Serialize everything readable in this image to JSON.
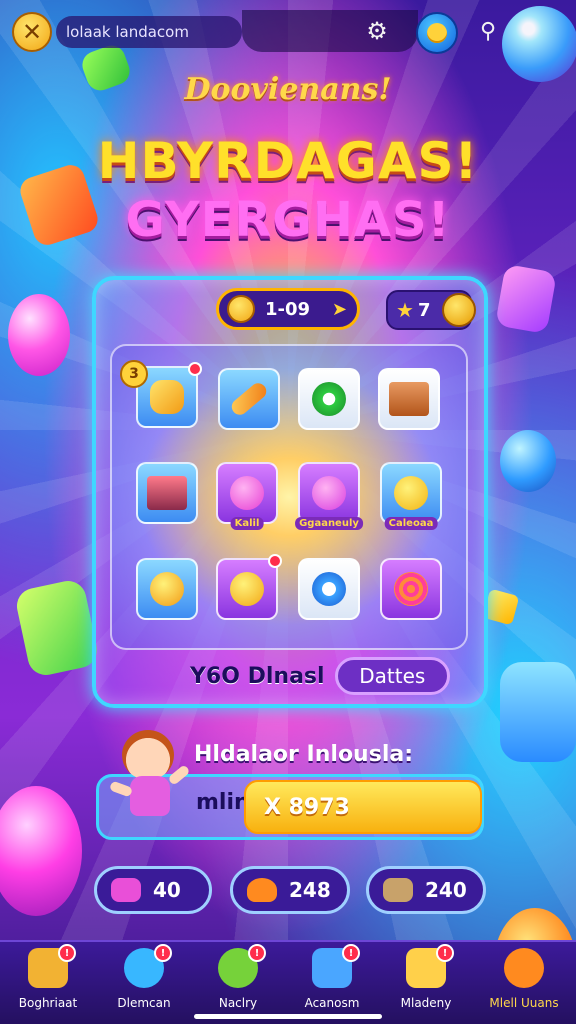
{
  "topbar": {
    "close_icon": "close-icon",
    "search_text": "lolaak landacom",
    "settings_icon": "gear-icon",
    "coin_icon": "coin-icon",
    "pin_icon": "location-pin-icon"
  },
  "titles": {
    "subtitle": "Doovienans!",
    "line1": "HBYRDAGAS!",
    "line2": "GYERGHAS!"
  },
  "panel": {
    "score": "1-09",
    "stars": "7",
    "tiles": [
      {
        "icon": "ice-cream-icon",
        "color": "blue",
        "badge": true,
        "num_badge": "3"
      },
      {
        "icon": "baguette-icon",
        "color": "blue",
        "badge": false
      },
      {
        "icon": "green-donut-icon",
        "color": "white",
        "badge": false
      },
      {
        "icon": "treasure-box-icon",
        "color": "white",
        "badge": false
      },
      {
        "icon": "book-stack-icon",
        "color": "blue",
        "badge": false
      },
      {
        "icon": "pink-monster-icon",
        "color": "purple",
        "badge": false,
        "tag": "Kalil"
      },
      {
        "icon": "pink-pig-icon",
        "color": "purple",
        "badge": false,
        "tag": "Ggaaneuly"
      },
      {
        "icon": "yellow-duck-icon",
        "color": "blue",
        "badge": false,
        "tag": "Caleoaa"
      },
      {
        "icon": "yellow-bear-icon",
        "color": "blue",
        "badge": false
      },
      {
        "icon": "smiley-icon",
        "color": "purple",
        "badge": true
      },
      {
        "icon": "blue-ring-icon",
        "color": "white",
        "badge": false
      },
      {
        "icon": "swirl-candy-icon",
        "color": "purple",
        "badge": false
      }
    ],
    "you_label": "Y6O Dlnasl",
    "daily_button": "Dattes"
  },
  "friends": {
    "label": "Hldalaor Inlousla:",
    "min_label": "mlin",
    "reward_value": "X 8973"
  },
  "resources": [
    {
      "icon": "candy-icon",
      "value": "40",
      "color": "#e94fd8"
    },
    {
      "icon": "fire-icon",
      "value": "248",
      "color": "#ff8a1f"
    },
    {
      "icon": "gift-icon",
      "value": "240",
      "color": "#c8a26a"
    }
  ],
  "nav": [
    {
      "label": "Boghriaat",
      "icon": "home-icon",
      "color": "#f2b233",
      "badge": "!"
    },
    {
      "label": "Dlemcan",
      "icon": "star-icon",
      "color": "#38b7ff",
      "badge": "!"
    },
    {
      "label": "Naclry",
      "icon": "lollipop-icon",
      "color": "#76d23a",
      "badge": "!"
    },
    {
      "label": "Acanosm",
      "icon": "robot-icon",
      "color": "#4aa6ff",
      "badge": "!"
    },
    {
      "label": "Mladeny",
      "icon": "face-icon",
      "color": "#ffd04a",
      "badge": "!"
    },
    {
      "label": "Mlell Uuans",
      "icon": "bubble-icon",
      "color": "#ff8a1f",
      "badge": ""
    }
  ]
}
